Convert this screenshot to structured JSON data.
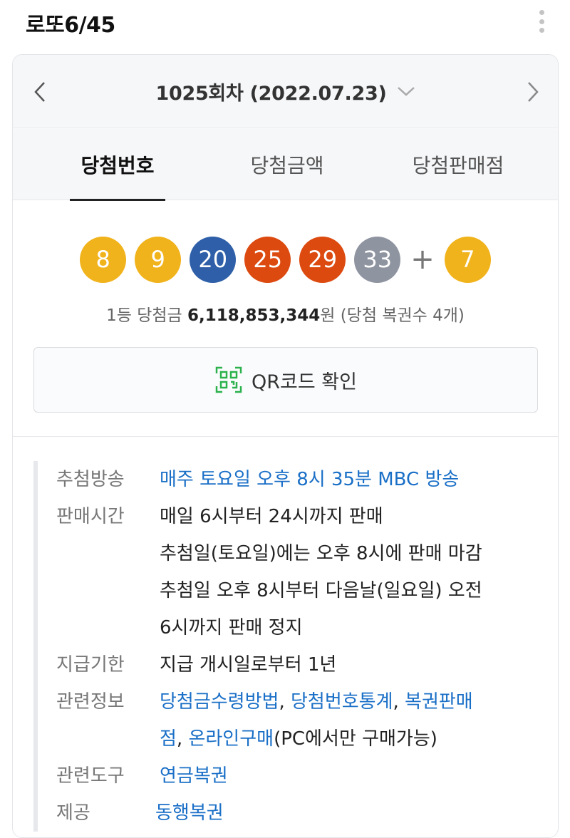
{
  "app": {
    "title": "로또6/45"
  },
  "round": {
    "title": "1025회차 (2022.07.23)"
  },
  "tabs": [
    {
      "label": "당첨번호"
    },
    {
      "label": "당첨금액"
    },
    {
      "label": "당첨판매점"
    }
  ],
  "numbers": {
    "main": [
      {
        "value": "8",
        "color": "#f1b31b"
      },
      {
        "value": "9",
        "color": "#f1b31b"
      },
      {
        "value": "20",
        "color": "#2e5fa8"
      },
      {
        "value": "25",
        "color": "#dc4a0f"
      },
      {
        "value": "29",
        "color": "#dc4a0f"
      },
      {
        "value": "33",
        "color": "#8f94a1"
      }
    ],
    "plus": "+",
    "bonus": {
      "value": "7",
      "color": "#f1b31b"
    }
  },
  "prize": {
    "prefix": "1등 당첨금 ",
    "amount": "6,118,853,344",
    "suffix": "원 (당첨 복권수 4개)"
  },
  "qr_button": {
    "label": "QR코드 확인",
    "icon": "qr-code-icon",
    "accent": "#2bb24c"
  },
  "info": {
    "broadcast": {
      "label": "추첨방송",
      "value": "매주 토요일 오후 8시 35분 MBC 방송"
    },
    "sales_time": {
      "label": "판매시간",
      "lines": [
        "매일 6시부터 24시까지 판매",
        "추첨일(토요일)에는 오후 8시에 판매 마감",
        "추첨일 오후 8시부터 다음날(일요일) 오전",
        "6시까지 판매 정지"
      ]
    },
    "deadline": {
      "label": "지급기한",
      "value": "지급 개시일로부터 1년"
    },
    "related_info": {
      "label": "관련정보",
      "links": [
        "당첨금수령방법",
        "당첨번호통계",
        "복권판매",
        "점",
        "온라인구매"
      ],
      "separator": ", ",
      "note": "(PC에서만 구매가능)"
    },
    "related_tools": {
      "label": "관련도구",
      "value": "연금복권"
    },
    "provider": {
      "label": "제공",
      "value": "동행복권"
    }
  },
  "colors": {
    "link": "#1a6fc7"
  }
}
